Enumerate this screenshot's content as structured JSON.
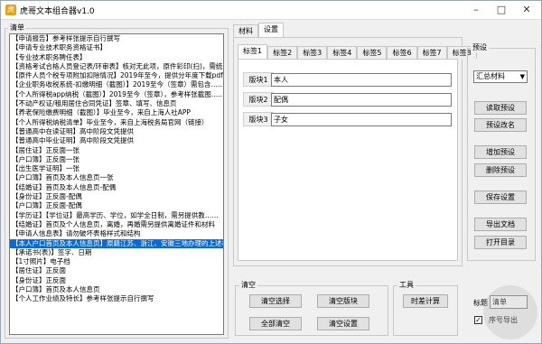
{
  "window": {
    "title": "虎哥文本组合器v1.0",
    "min_icon": "minimize-icon",
    "max_icon": "maximize-icon",
    "close_icon": "close-icon"
  },
  "list_group": {
    "label": "清单",
    "items": [
      "【申请报告】参考样张提示自行撰写",
      "【申请专业技术职务资格证书】",
      "【专业技术职务聘任表】",
      "【资格考试合格人员登记表/环审表】核对无此项，原件彩印(扫)，需统一",
      "【原件人员个税专项附加扣除情况】2019年至今，提供分年度下载pdf原件……",
      "【企业职务收税系统-扣缴明细（截图）】2019至今（签章）需包含……",
      "【个人所得税app纳税（截图）】2019至今（签章），参考样张截图……",
      "【不动产权证/租用居住合同凭证】签章、填写、信息页",
      "【养老保险缴费明细（截图）】毕业至今，来自上海人社APP",
      "【个人所得税纳税清单】毕业至今，来自上海税务局官网（链接）",
      "【普通高中在读证明】高中阶段文凭提供",
      "【普通高中毕业证明】高中阶段文凭提供",
      "【居住证】正反面一张",
      "【户口簿】正反面一张",
      "【出生医学证明】一张",
      "【户口簿】首页及本人信息页一张",
      "【结婚证】首页及本人信息页-配偶",
      "【身份证】正反面-配偶",
      "【户口簿】正反面-配偶",
      "【学历证】【学位证】最高学历、学位，如学全日制，需另提供教……",
      "【结婚证】首页及个人信息页，离婚，再婚需另提供离婚证件和材料",
      "【申请人信息表】请勿破坏表格样式和结构",
      "【本人户口首页及本人信息页】原籍江苏、浙江、安徽三地办理的上述材料",
      "【承诺书(表)】签字、日期",
      "【1寸照片】电子档",
      "【居住证】正反面",
      "【身份证】正反面",
      "【户口簿】首页及本人信息页",
      "【个人工作业绩及特长】参考样张提示自行撰写"
    ],
    "selected_index": 22
  },
  "outer_tabs": [
    "材料",
    "设置"
  ],
  "inner_tabs": [
    "标签1",
    "标签2",
    "标签3",
    "标签4",
    "标签5",
    "标签6",
    "标签7",
    "标签8"
  ],
  "active_inner_tab": 0,
  "fields": [
    {
      "label": "版块1",
      "value": "本人"
    },
    {
      "label": "版块2",
      "value": "配偶"
    },
    {
      "label": "版块3",
      "value": "子女"
    }
  ],
  "clear_group": {
    "label": "清空",
    "clear_selection": "清空选择",
    "clear_blocks": "清空版块",
    "clear_all": "全部清空",
    "clear_settings": "清空设置"
  },
  "tools_group": {
    "label": "工具",
    "time_calc": "时差计算"
  },
  "preset_group": {
    "label": "预设",
    "select_value": "汇总材料",
    "read_preset": "读取预设",
    "rename_preset": "预设改名",
    "add_preset": "增加预设",
    "delete_preset": "删除预设",
    "save_settings": "保存设置",
    "export_doc": "导出文档",
    "open_dir": "打开目录"
  },
  "bottom": {
    "title_label": "标题",
    "title_value": "清单",
    "seq_label": "序号",
    "export_label": "导出"
  },
  "colors": {
    "selection": "#0a6ad7",
    "accent": "#e8a31c"
  }
}
